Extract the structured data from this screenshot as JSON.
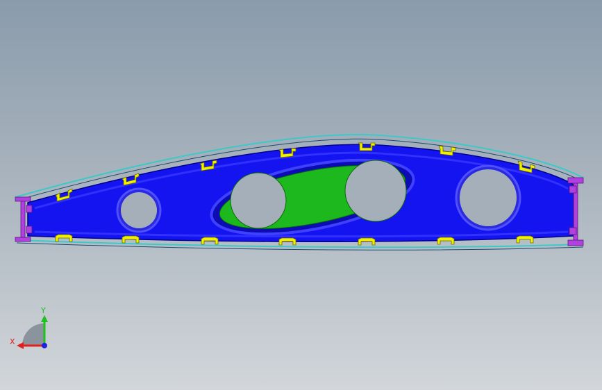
{
  "viewport": {
    "background_top": "#8a9bab",
    "background_bottom": "#d2d6da"
  },
  "model": {
    "colors": {
      "rib_web": "#1414f0",
      "rib_flange": "#0a0acc",
      "pocket_fill": "#1db81d",
      "stiffener_clips": "#f0f000",
      "spar_caps": "#b040e0",
      "skin_outline": "#3ec8c8"
    }
  },
  "triad": {
    "x_label": "X",
    "y_label": "Y",
    "x_color": "#e02020",
    "y_color": "#20c020",
    "z_color": "#2020e0"
  }
}
